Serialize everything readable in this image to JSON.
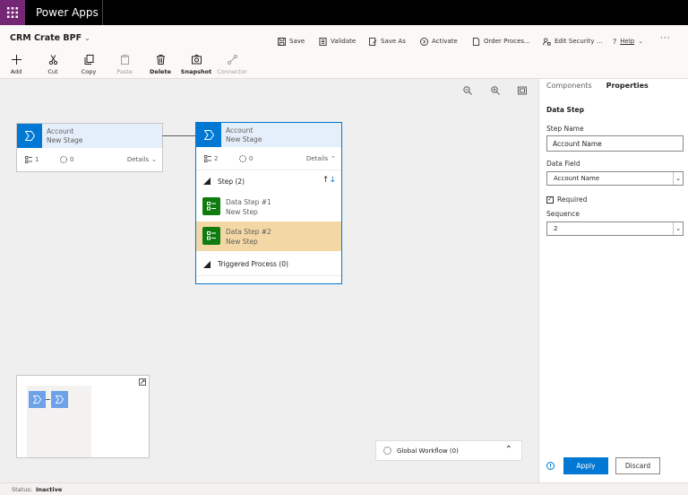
{
  "app": {
    "name": "Power Apps"
  },
  "process": {
    "title": "CRM Crate BPF"
  },
  "toolbar_top": [
    {
      "label": "Save",
      "icon": "save-icon"
    },
    {
      "label": "Validate",
      "icon": "validate-icon"
    },
    {
      "label": "Save As",
      "icon": "save-as-icon"
    },
    {
      "label": "Activate",
      "icon": "activate-icon"
    },
    {
      "label": "Order Proces...",
      "icon": "order-icon"
    },
    {
      "label": "Edit Security ...",
      "icon": "security-icon"
    },
    {
      "label": "Help",
      "icon": "help-icon"
    }
  ],
  "toolbar_tools": [
    {
      "label": "Add",
      "icon": "plus-icon"
    },
    {
      "label": "Cut",
      "icon": "cut-icon"
    },
    {
      "label": "Copy",
      "icon": "copy-icon"
    },
    {
      "label": "Paste",
      "icon": "paste-icon"
    },
    {
      "label": "Delete",
      "icon": "delete-icon"
    },
    {
      "label": "Snapshot",
      "icon": "snapshot-icon"
    },
    {
      "label": "Connector",
      "icon": "connector-icon"
    }
  ],
  "stages": [
    {
      "entity": "Account",
      "name": "New Stage",
      "steps_count": "1",
      "flows_count": "0",
      "details_label": "Details"
    },
    {
      "entity": "Account",
      "name": "New Stage",
      "steps_count": "2",
      "flows_count": "0",
      "details_label": "Details",
      "step_section": "Step (2)",
      "steps": [
        {
          "title": "Data Step #1",
          "subtitle": "New Step"
        },
        {
          "title": "Data Step #2",
          "subtitle": "New Step"
        }
      ],
      "triggered_section": "Triggered Process (0)"
    }
  ],
  "global_workflow": {
    "label": "Global Workflow (0)"
  },
  "panel": {
    "tabs": [
      "Components",
      "Properties"
    ],
    "section_title": "Data Step",
    "step_name_label": "Step Name",
    "step_name_value": "Account Name",
    "data_field_label": "Data Field",
    "data_field_value": "Account Name",
    "required_label": "Required",
    "sequence_label": "Sequence",
    "sequence_value": "2",
    "apply_label": "Apply",
    "discard_label": "Discard"
  },
  "status": {
    "label": "Status:",
    "value": "Inactive"
  },
  "colors": {
    "accent": "#0078d4",
    "step_green": "#107c10",
    "selected_step": "#f3d8a6",
    "waffle": "#742774"
  }
}
